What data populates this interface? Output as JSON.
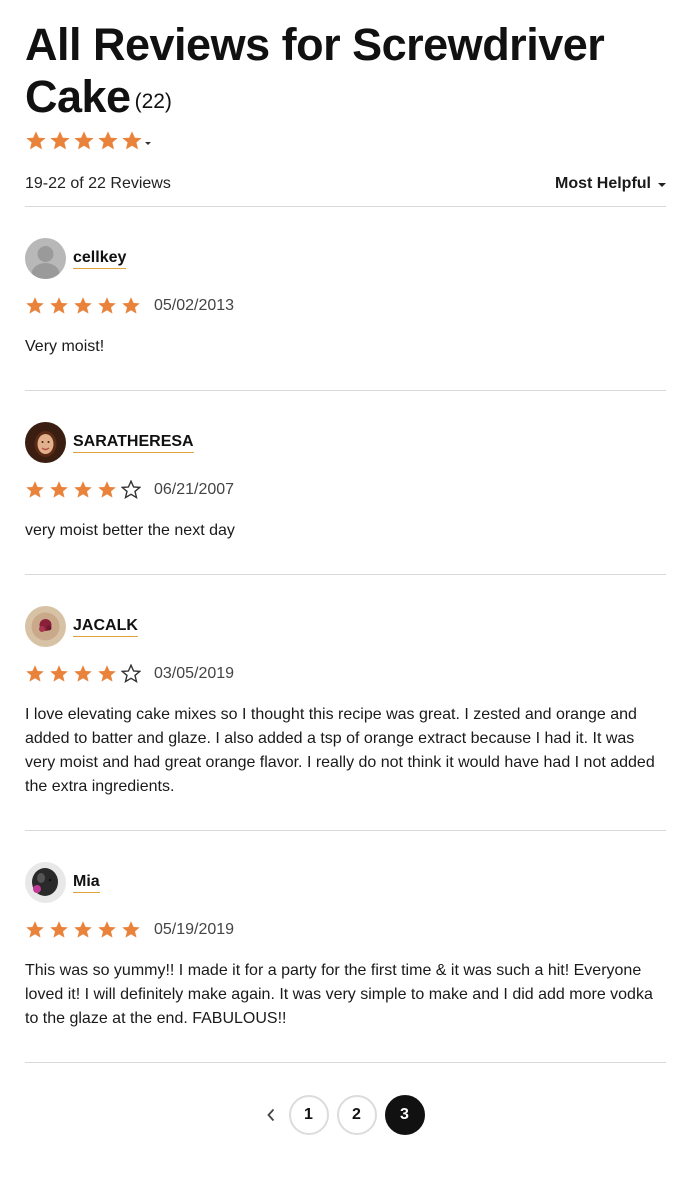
{
  "header": {
    "title": "All Reviews for Screwdriver Cake",
    "count": "(22)",
    "overall_rating": 5
  },
  "toolbar": {
    "range_text": "19-22 of 22 Reviews",
    "sort_label": "Most Helpful"
  },
  "colors": {
    "star": "#e9823b",
    "star_empty_stroke": "#333333",
    "underline": "#e0a23a",
    "divider": "#d9d9d9"
  },
  "reviews": [
    {
      "name": "cellkey",
      "rating": 5,
      "date": "05/02/2013",
      "text": "Very moist!",
      "avatar": "default-avatar"
    },
    {
      "name": "SARATHERESA",
      "rating": 4,
      "date": "06/21/2007",
      "text": "very moist better the next day",
      "avatar": "photo-avatar"
    },
    {
      "name": "JACALK",
      "rating": 4,
      "date": "03/05/2019",
      "text": "I love elevating cake mixes so I thought this recipe was great. I zested and orange and added to batter and glaze. I also added a tsp of orange extract because I had it. It was very moist and had great orange flavor. I really do not think it would have had I not added the extra ingredients.",
      "avatar": "photo-avatar"
    },
    {
      "name": "Mia",
      "rating": 5,
      "date": "05/19/2019",
      "text": "This was so yummy!! I made it for a party for the first time & it was such a hit! Everyone loved it! I will definitely make again. It was very simple to make and I did add more vodka to the glaze at the end. FABULOUS!!",
      "avatar": "photo-avatar"
    }
  ],
  "pagination": {
    "prev_icon": "chevron-left-icon",
    "pages": [
      "1",
      "2",
      "3"
    ],
    "current": "3"
  }
}
